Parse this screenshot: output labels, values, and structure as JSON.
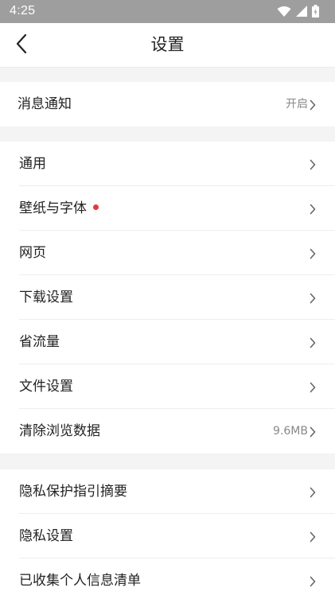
{
  "status_bar": {
    "time": "4:25",
    "icons": [
      "wifi-icon",
      "cellular-signal-icon",
      "battery-icon"
    ]
  },
  "header": {
    "back_icon": "chevron-left-icon",
    "title": "设置"
  },
  "sections": [
    {
      "items": [
        {
          "label": "消息通知",
          "value": "开启"
        }
      ]
    },
    {
      "items": [
        {
          "label": "通用",
          "value": ""
        },
        {
          "label": "壁纸与字体",
          "value": "",
          "badge": "red-dot"
        },
        {
          "label": "网页",
          "value": ""
        },
        {
          "label": "下载设置",
          "value": ""
        },
        {
          "label": "省流量",
          "value": ""
        },
        {
          "label": "文件设置",
          "value": ""
        },
        {
          "label": "清除浏览数据",
          "value": "9.6MB"
        }
      ]
    },
    {
      "items": [
        {
          "label": "隐私保护指引摘要",
          "value": ""
        },
        {
          "label": "隐私设置",
          "value": ""
        },
        {
          "label": "已收集个人信息清单",
          "value": ""
        }
      ]
    }
  ],
  "colors": {
    "status_bar_bg": "#9e9e9e",
    "section_gap_bg": "#f4f4f4",
    "badge_red": "#e53935",
    "secondary_text": "#888888"
  }
}
